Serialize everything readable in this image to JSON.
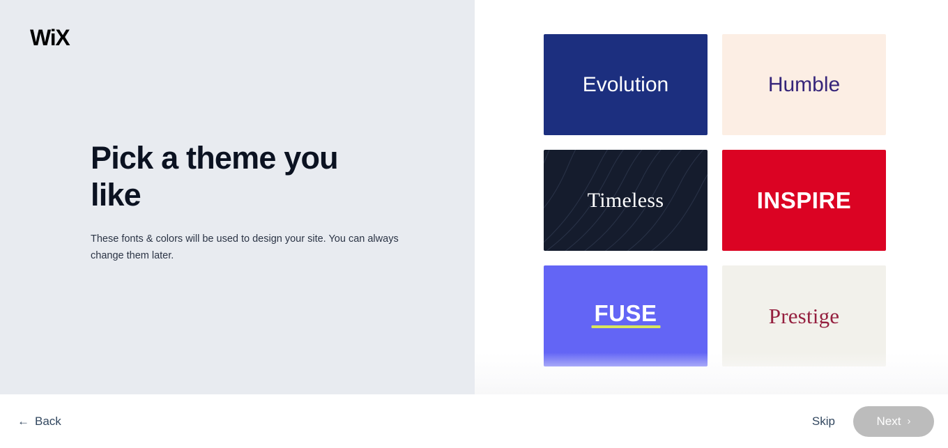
{
  "brand": {
    "logo_text": "WiX",
    "logo_color": "#000000"
  },
  "left": {
    "headline": "Pick a theme you like",
    "subcopy": "These fonts & colors will be used to design your site. You can always change them later."
  },
  "themes": [
    {
      "name": "Evolution",
      "bg": "#1c2f7f",
      "text_color": "#ffffff",
      "style": "sans"
    },
    {
      "name": "Humble",
      "bg": "#fceee4",
      "text_color": "#36257a",
      "style": "sans"
    },
    {
      "name": "Timeless",
      "bg": "#151c2d",
      "text_color": "#ffffff",
      "style": "serif",
      "texture": "waves"
    },
    {
      "name": "INSPIRE",
      "bg": "#db0323",
      "text_color": "#ffffff",
      "style": "sans-bold"
    },
    {
      "name": "FUSE",
      "bg": "#6365f5",
      "text_color": "#ffffff",
      "style": "sans-bold",
      "accent": "#d9e65c",
      "underline": true
    },
    {
      "name": "Prestige",
      "bg": "#f2f1eb",
      "text_color": "#95203f",
      "style": "serif"
    }
  ],
  "footer": {
    "back_label": "Back",
    "back_arrow": "←",
    "skip_label": "Skip",
    "next_label": "Next",
    "next_chevron": "›",
    "next_disabled_color": "#bcbcbc"
  }
}
